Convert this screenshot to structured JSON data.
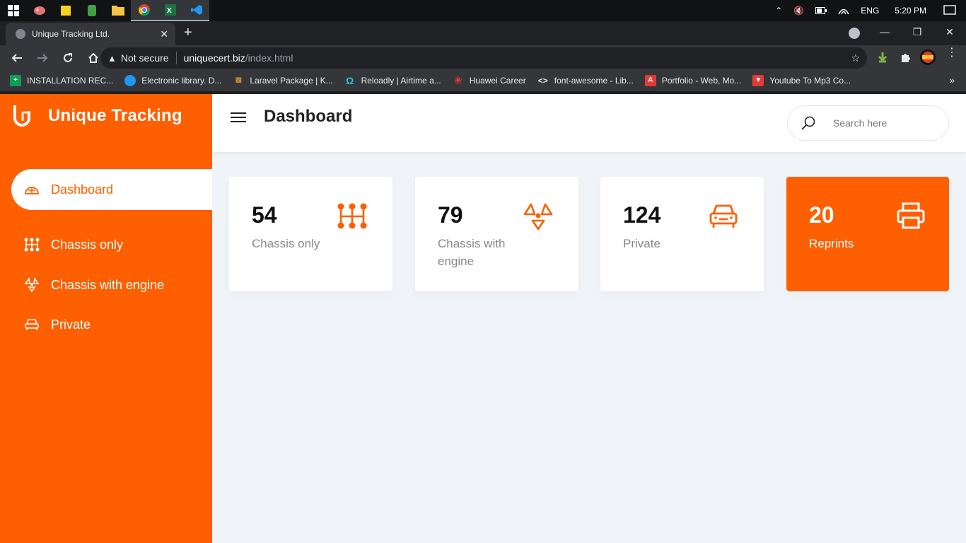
{
  "taskbar": {
    "language": "ENG",
    "time": "5:20 PM"
  },
  "browser": {
    "tab_title": "Unique Tracking Ltd.",
    "security_label": "Not secure",
    "url_host": "uniquecert.biz",
    "url_path": "/index.html",
    "bookmarks": [
      {
        "label": "INSTALLATION REC...",
        "color": "#0f9d58",
        "icon": "sheets-icon"
      },
      {
        "label": "Electronic library. D...",
        "color": "#2196f3",
        "icon": "globe-icon"
      },
      {
        "label": "Laravel Package | K...",
        "color": "#f4a524",
        "icon": "chart-icon"
      },
      {
        "label": "Reloadly | Airtime a...",
        "color": "#26c6da",
        "icon": "reloadly-icon"
      },
      {
        "label": "Huawei Career",
        "color": "#e53935",
        "icon": "huawei-icon"
      },
      {
        "label": "font-awesome - Lib...",
        "color": "#e8eaed",
        "icon": "code-icon"
      },
      {
        "label": "Portfolio - Web, Mo...",
        "color": "#e53935",
        "icon": "portfolio-icon"
      },
      {
        "label": "Youtube To Mp3 Co...",
        "color": "#e53935",
        "icon": "download-icon"
      }
    ]
  },
  "app": {
    "brand": "Unique Tracking",
    "accent": "#fe5f00",
    "page_title": "Dashboard",
    "search_placeholder": "Search here",
    "nav": [
      {
        "label": "Dashboard",
        "icon": "dashboard-icon",
        "active": true
      },
      {
        "label": "Chassis only",
        "icon": "chassis-icon",
        "active": false
      },
      {
        "label": "Chassis with engine",
        "icon": "engine-icon",
        "active": false
      },
      {
        "label": "Private",
        "icon": "car-icon",
        "active": false
      }
    ],
    "cards": [
      {
        "value": "54",
        "label": "Chassis only",
        "icon": "chassis-icon"
      },
      {
        "value": "79",
        "label": "Chassis with engine",
        "icon": "engine-icon"
      },
      {
        "value": "124",
        "label": "Private",
        "icon": "car-icon"
      },
      {
        "value": "20",
        "label": "Reprints",
        "icon": "printer-icon"
      }
    ]
  }
}
